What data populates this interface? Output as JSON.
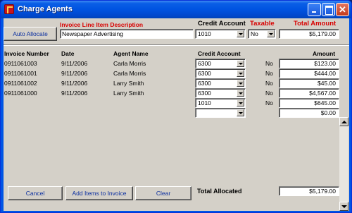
{
  "window": {
    "title": "Charge Agents"
  },
  "header": {
    "auto_allocate": "Auto Allocate",
    "desc_label": "Invoice Line Item Description",
    "desc_value": "Newspaper Advertising",
    "credit_label": "Credit Account",
    "credit_value": "1010",
    "taxable_label": "Taxable",
    "taxable_value": "No",
    "total_label": "Total Amount",
    "total_value": "$5,179.00"
  },
  "table": {
    "columns": {
      "invoice_number": "Invoice Number",
      "date": "Date",
      "agent_name": "Agent Name",
      "credit_account": "Credit Account",
      "amount": "Amount"
    },
    "rows": [
      {
        "invoice": "0911061003",
        "date": "9/11/2006",
        "agent": "Carla Morris",
        "account": "6300",
        "taxable": "No",
        "amount": "$123.00"
      },
      {
        "invoice": "0911061001",
        "date": "9/11/2006",
        "agent": "Carla Morris",
        "account": "6300",
        "taxable": "No",
        "amount": "$444.00"
      },
      {
        "invoice": "0911061002",
        "date": "9/11/2006",
        "agent": "Larry Smith",
        "account": "6300",
        "taxable": "No",
        "amount": "$45.00"
      },
      {
        "invoice": "0911061000",
        "date": "9/11/2006",
        "agent": "Larry Smith",
        "account": "6300",
        "taxable": "No",
        "amount": "$4,567.00"
      },
      {
        "invoice": "",
        "date": "",
        "agent": "",
        "account": "1010",
        "taxable": "No",
        "amount": "$645.00"
      },
      {
        "invoice": "",
        "date": "",
        "agent": "",
        "account": "",
        "taxable": "",
        "amount": "$0.00"
      }
    ]
  },
  "footer": {
    "cancel": "Cancel",
    "add_items": "Add Items to Invoice",
    "clear": "Clear",
    "total_allocated_label": "Total Allocated",
    "total_allocated_value": "$5,179.00"
  },
  "colors": {
    "title_bar": "#0053e1",
    "client": "#d4d0c8",
    "red_label": "#d80000",
    "button_text": "#0a2ea0"
  },
  "icons": [
    "app-icon",
    "minimize-icon",
    "maximize-icon",
    "close-icon",
    "dropdown-arrow-icon",
    "scroll-up-icon",
    "scroll-down-icon"
  ]
}
